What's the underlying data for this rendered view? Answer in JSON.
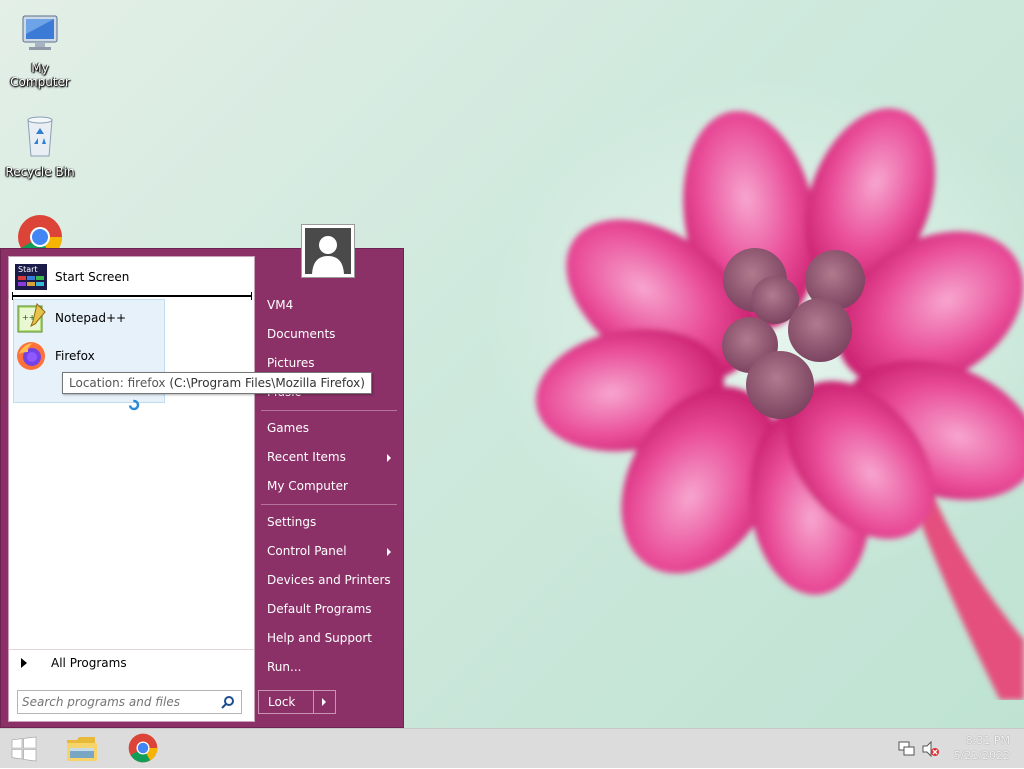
{
  "desktop": {
    "icons": [
      {
        "label": "My Computer",
        "icon": "computer-icon"
      },
      {
        "label": "Recycle Bin",
        "icon": "recycle-bin-icon"
      },
      {
        "label": "",
        "icon": "chrome-icon"
      }
    ]
  },
  "start_menu": {
    "pinned": [
      {
        "label": "Start Screen",
        "icon": "start-screen-icon",
        "icon_text": "Start"
      },
      {
        "label": "Notepad++",
        "icon": "notepad-plus-plus-icon"
      },
      {
        "label": "Firefox",
        "icon": "firefox-icon"
      }
    ],
    "tooltip": {
      "prefix": "Location: firefox",
      "path": "(C:\\Program Files\\Mozilla Firefox)"
    },
    "all_programs": "All Programs",
    "search_placeholder": "Search programs and files",
    "right_items": {
      "user": "VM4",
      "documents": "Documents",
      "pictures": "Pictures",
      "music": "Music",
      "games": "Games",
      "recent_items": "Recent Items",
      "my_computer": "My Computer",
      "settings": "Settings",
      "control_panel": "Control Panel",
      "devices_printers": "Devices and Printers",
      "default_programs": "Default Programs",
      "help_support": "Help and Support",
      "run": "Run..."
    },
    "lock": "Lock",
    "accent_color": "#8c3168"
  },
  "taskbar": {
    "time": "8:31 PM",
    "date": "5/21/2022",
    "pinned": [
      "start-button",
      "file-explorer-icon",
      "chrome-icon"
    ]
  }
}
